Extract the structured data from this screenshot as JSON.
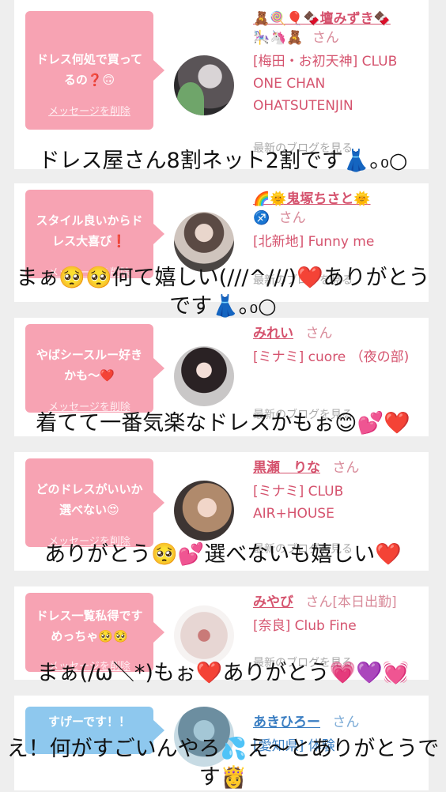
{
  "comments": [
    {
      "message": "ドレス何処で買ってるの❓🙃",
      "delete_label": "メッセージを削除",
      "name": "🧸🍭🎈🍫壇みずき🍫",
      "name_line2": "🎠🦄🧸",
      "san": "さん",
      "shop": "[梅田・お初天神] CLUB ONE CHAN OHATSUTENJIN",
      "blog_label": "最新のブログを見る",
      "reply_overlay": "ドレス屋さん8割ネット2割です👗｡₀○",
      "colors": {
        "bubble": "#f7a3b3",
        "name": "#d5536e"
      }
    },
    {
      "message": "スタイル良いからドレス大喜び❗️",
      "delete_label": "メッセージを削除",
      "name": "🌈🌞鬼塚ちさと🌞",
      "name_line2": "♐️",
      "san": "さん",
      "shop": "[北新地] Funny me",
      "blog_label": "最新のブログを見る",
      "reply_overlay": "まぁ🥺🥺何て嬉しい(///^///)❤️ありがとうです👗｡₀○"
    },
    {
      "message": "やばシースルー好きかも〜❤️",
      "delete_label": "メッセージを削除",
      "name": "みれい",
      "san": "さん",
      "shop": "[ミナミ] cuore （夜の部)",
      "blog_label": "最新のブログを見る",
      "reply_overlay": "着てて一番気楽なドレスかもぉ😊💕❤️"
    },
    {
      "message": "どのドレスがいいか選べない😍",
      "delete_label": "メッセージを削除",
      "name": "黒瀬　りな",
      "san": "さん",
      "shop": "[ミナミ] CLUB AIR+HOUSE",
      "blog_label": "最新のブログを見る",
      "reply_overlay": "ありがとう🥺💕選べないも嬉しい❤️"
    },
    {
      "message": "ドレス一覧私得ですめっちゃ🥺🥺",
      "delete_label": "メッセージを削除",
      "name": "みやび",
      "san": "さん[本日出勤]",
      "shop": "[奈良] Club Fine",
      "blog_label": "最新のブログを見る",
      "reply_overlay": "まぁ(/ω＼*)もぉ❤️ありがとう💗💜💓"
    },
    {
      "message": "すげーです！！",
      "name": "あきひろー",
      "san": "さん",
      "shop": "[愛知県] 体験",
      "reply_overlay": "え！何がすごいんやろ💦え〜とありがとうです👸",
      "colors": {
        "bubble": "#8ec8ee",
        "name": "#3a7ec2"
      }
    }
  ]
}
